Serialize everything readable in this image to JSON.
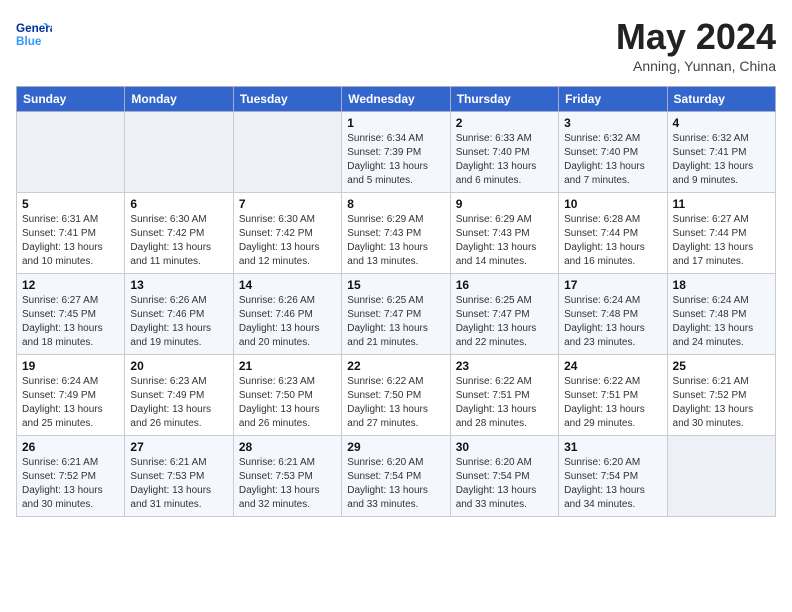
{
  "header": {
    "logo_line1": "General",
    "logo_line2": "Blue",
    "month_year": "May 2024",
    "location": "Anning, Yunnan, China"
  },
  "columns": [
    "Sunday",
    "Monday",
    "Tuesday",
    "Wednesday",
    "Thursday",
    "Friday",
    "Saturday"
  ],
  "rows": [
    [
      {
        "day": "",
        "text": ""
      },
      {
        "day": "",
        "text": ""
      },
      {
        "day": "",
        "text": ""
      },
      {
        "day": "1",
        "text": "Sunrise: 6:34 AM\nSunset: 7:39 PM\nDaylight: 13 hours\nand 5 minutes."
      },
      {
        "day": "2",
        "text": "Sunrise: 6:33 AM\nSunset: 7:40 PM\nDaylight: 13 hours\nand 6 minutes."
      },
      {
        "day": "3",
        "text": "Sunrise: 6:32 AM\nSunset: 7:40 PM\nDaylight: 13 hours\nand 7 minutes."
      },
      {
        "day": "4",
        "text": "Sunrise: 6:32 AM\nSunset: 7:41 PM\nDaylight: 13 hours\nand 9 minutes."
      }
    ],
    [
      {
        "day": "5",
        "text": "Sunrise: 6:31 AM\nSunset: 7:41 PM\nDaylight: 13 hours\nand 10 minutes."
      },
      {
        "day": "6",
        "text": "Sunrise: 6:30 AM\nSunset: 7:42 PM\nDaylight: 13 hours\nand 11 minutes."
      },
      {
        "day": "7",
        "text": "Sunrise: 6:30 AM\nSunset: 7:42 PM\nDaylight: 13 hours\nand 12 minutes."
      },
      {
        "day": "8",
        "text": "Sunrise: 6:29 AM\nSunset: 7:43 PM\nDaylight: 13 hours\nand 13 minutes."
      },
      {
        "day": "9",
        "text": "Sunrise: 6:29 AM\nSunset: 7:43 PM\nDaylight: 13 hours\nand 14 minutes."
      },
      {
        "day": "10",
        "text": "Sunrise: 6:28 AM\nSunset: 7:44 PM\nDaylight: 13 hours\nand 16 minutes."
      },
      {
        "day": "11",
        "text": "Sunrise: 6:27 AM\nSunset: 7:44 PM\nDaylight: 13 hours\nand 17 minutes."
      }
    ],
    [
      {
        "day": "12",
        "text": "Sunrise: 6:27 AM\nSunset: 7:45 PM\nDaylight: 13 hours\nand 18 minutes."
      },
      {
        "day": "13",
        "text": "Sunrise: 6:26 AM\nSunset: 7:46 PM\nDaylight: 13 hours\nand 19 minutes."
      },
      {
        "day": "14",
        "text": "Sunrise: 6:26 AM\nSunset: 7:46 PM\nDaylight: 13 hours\nand 20 minutes."
      },
      {
        "day": "15",
        "text": "Sunrise: 6:25 AM\nSunset: 7:47 PM\nDaylight: 13 hours\nand 21 minutes."
      },
      {
        "day": "16",
        "text": "Sunrise: 6:25 AM\nSunset: 7:47 PM\nDaylight: 13 hours\nand 22 minutes."
      },
      {
        "day": "17",
        "text": "Sunrise: 6:24 AM\nSunset: 7:48 PM\nDaylight: 13 hours\nand 23 minutes."
      },
      {
        "day": "18",
        "text": "Sunrise: 6:24 AM\nSunset: 7:48 PM\nDaylight: 13 hours\nand 24 minutes."
      }
    ],
    [
      {
        "day": "19",
        "text": "Sunrise: 6:24 AM\nSunset: 7:49 PM\nDaylight: 13 hours\nand 25 minutes."
      },
      {
        "day": "20",
        "text": "Sunrise: 6:23 AM\nSunset: 7:49 PM\nDaylight: 13 hours\nand 26 minutes."
      },
      {
        "day": "21",
        "text": "Sunrise: 6:23 AM\nSunset: 7:50 PM\nDaylight: 13 hours\nand 26 minutes."
      },
      {
        "day": "22",
        "text": "Sunrise: 6:22 AM\nSunset: 7:50 PM\nDaylight: 13 hours\nand 27 minutes."
      },
      {
        "day": "23",
        "text": "Sunrise: 6:22 AM\nSunset: 7:51 PM\nDaylight: 13 hours\nand 28 minutes."
      },
      {
        "day": "24",
        "text": "Sunrise: 6:22 AM\nSunset: 7:51 PM\nDaylight: 13 hours\nand 29 minutes."
      },
      {
        "day": "25",
        "text": "Sunrise: 6:21 AM\nSunset: 7:52 PM\nDaylight: 13 hours\nand 30 minutes."
      }
    ],
    [
      {
        "day": "26",
        "text": "Sunrise: 6:21 AM\nSunset: 7:52 PM\nDaylight: 13 hours\nand 30 minutes."
      },
      {
        "day": "27",
        "text": "Sunrise: 6:21 AM\nSunset: 7:53 PM\nDaylight: 13 hours\nand 31 minutes."
      },
      {
        "day": "28",
        "text": "Sunrise: 6:21 AM\nSunset: 7:53 PM\nDaylight: 13 hours\nand 32 minutes."
      },
      {
        "day": "29",
        "text": "Sunrise: 6:20 AM\nSunset: 7:54 PM\nDaylight: 13 hours\nand 33 minutes."
      },
      {
        "day": "30",
        "text": "Sunrise: 6:20 AM\nSunset: 7:54 PM\nDaylight: 13 hours\nand 33 minutes."
      },
      {
        "day": "31",
        "text": "Sunrise: 6:20 AM\nSunset: 7:54 PM\nDaylight: 13 hours\nand 34 minutes."
      },
      {
        "day": "",
        "text": ""
      }
    ]
  ]
}
